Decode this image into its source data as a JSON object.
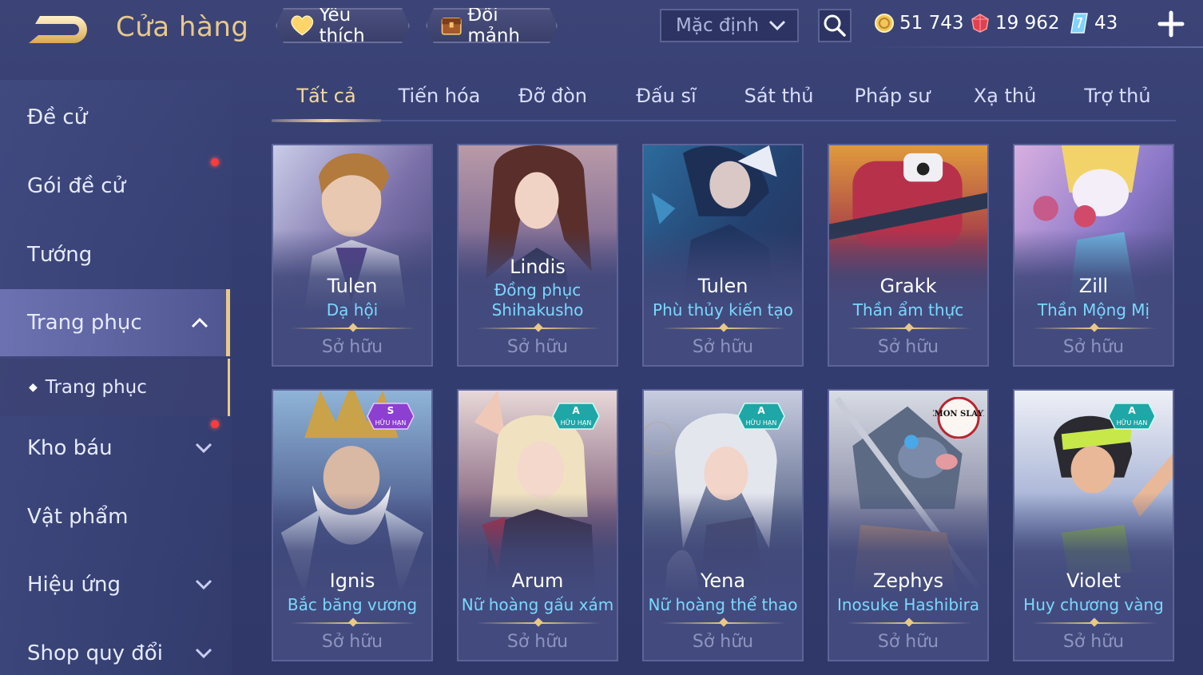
{
  "header": {
    "title": "Cửa hàng",
    "favorite_label": "Yêu thích",
    "shard_label": "Đổi mảnh",
    "sort_selected": "Mặc định",
    "currencies": [
      {
        "icon": "gold-coin-icon",
        "value": "51 743"
      },
      {
        "icon": "ruby-gem-icon",
        "value": "19 962"
      },
      {
        "icon": "crystal-voucher-icon",
        "value": "43"
      }
    ]
  },
  "sidebar": {
    "items": [
      {
        "label": "Đề cử",
        "dot": false
      },
      {
        "label": "Gói đề cử",
        "dot": true
      },
      {
        "label": "Tướng",
        "dot": false
      },
      {
        "label": "Trang phục",
        "dot": false,
        "expanded": true
      },
      {
        "label": "Trang phục",
        "sub": true
      },
      {
        "label": "Kho báu",
        "dot": true
      },
      {
        "label": "Vật phẩm",
        "dot": false
      },
      {
        "label": "Hiệu ứng",
        "dot": false
      },
      {
        "label": "Shop quy đổi",
        "dot": false
      }
    ]
  },
  "tabs": [
    "Tất cả",
    "Tiến hóa",
    "Đỡ đòn",
    "Đấu sĩ",
    "Sát thủ",
    "Pháp sư",
    "Xạ thủ",
    "Trợ thủ"
  ],
  "cards": [
    {
      "hero": "Tulen",
      "skin": "Dạ hội",
      "status": "Sở hữu",
      "badge": ""
    },
    {
      "hero": "Lindis",
      "skin": "Đồng phục Shihakusho",
      "status": "Sở hữu",
      "badge": ""
    },
    {
      "hero": "Tulen",
      "skin": "Phù thủy kiến tạo",
      "status": "Sở hữu",
      "badge": ""
    },
    {
      "hero": "Grakk",
      "skin": "Thần ẩm thực",
      "status": "Sở hữu",
      "badge": ""
    },
    {
      "hero": "Zill",
      "skin": "Thần Mộng Mị",
      "status": "Sở hữu",
      "badge": ""
    },
    {
      "hero": "Ignis",
      "skin": "Bắc băng vương",
      "status": "Sở hữu",
      "badge": "S",
      "badge_text": "HỮU HẠN"
    },
    {
      "hero": "Arum",
      "skin": "Nữ hoàng gấu xám",
      "status": "Sở hữu",
      "badge": "A",
      "badge_text": "HỮU HẠN"
    },
    {
      "hero": "Yena",
      "skin": "Nữ hoàng thể thao",
      "status": "Sở hữu",
      "badge": "A",
      "badge_text": "HỮU HẠN"
    },
    {
      "hero": "Zephys",
      "skin": "Inosuke Hashibira",
      "status": "Sở hữu",
      "badge": "DEMON SLAYER"
    },
    {
      "hero": "Violet",
      "skin": "Huy chương vàng",
      "status": "Sở hữu",
      "badge": "A",
      "badge_text": "HỮU HẠN"
    }
  ],
  "colors": {
    "accent_gold": "#e9c98a",
    "skin_name": "#7ad8ff",
    "badge_s": "#8c3fd1",
    "badge_a": "#1fa6a6"
  }
}
